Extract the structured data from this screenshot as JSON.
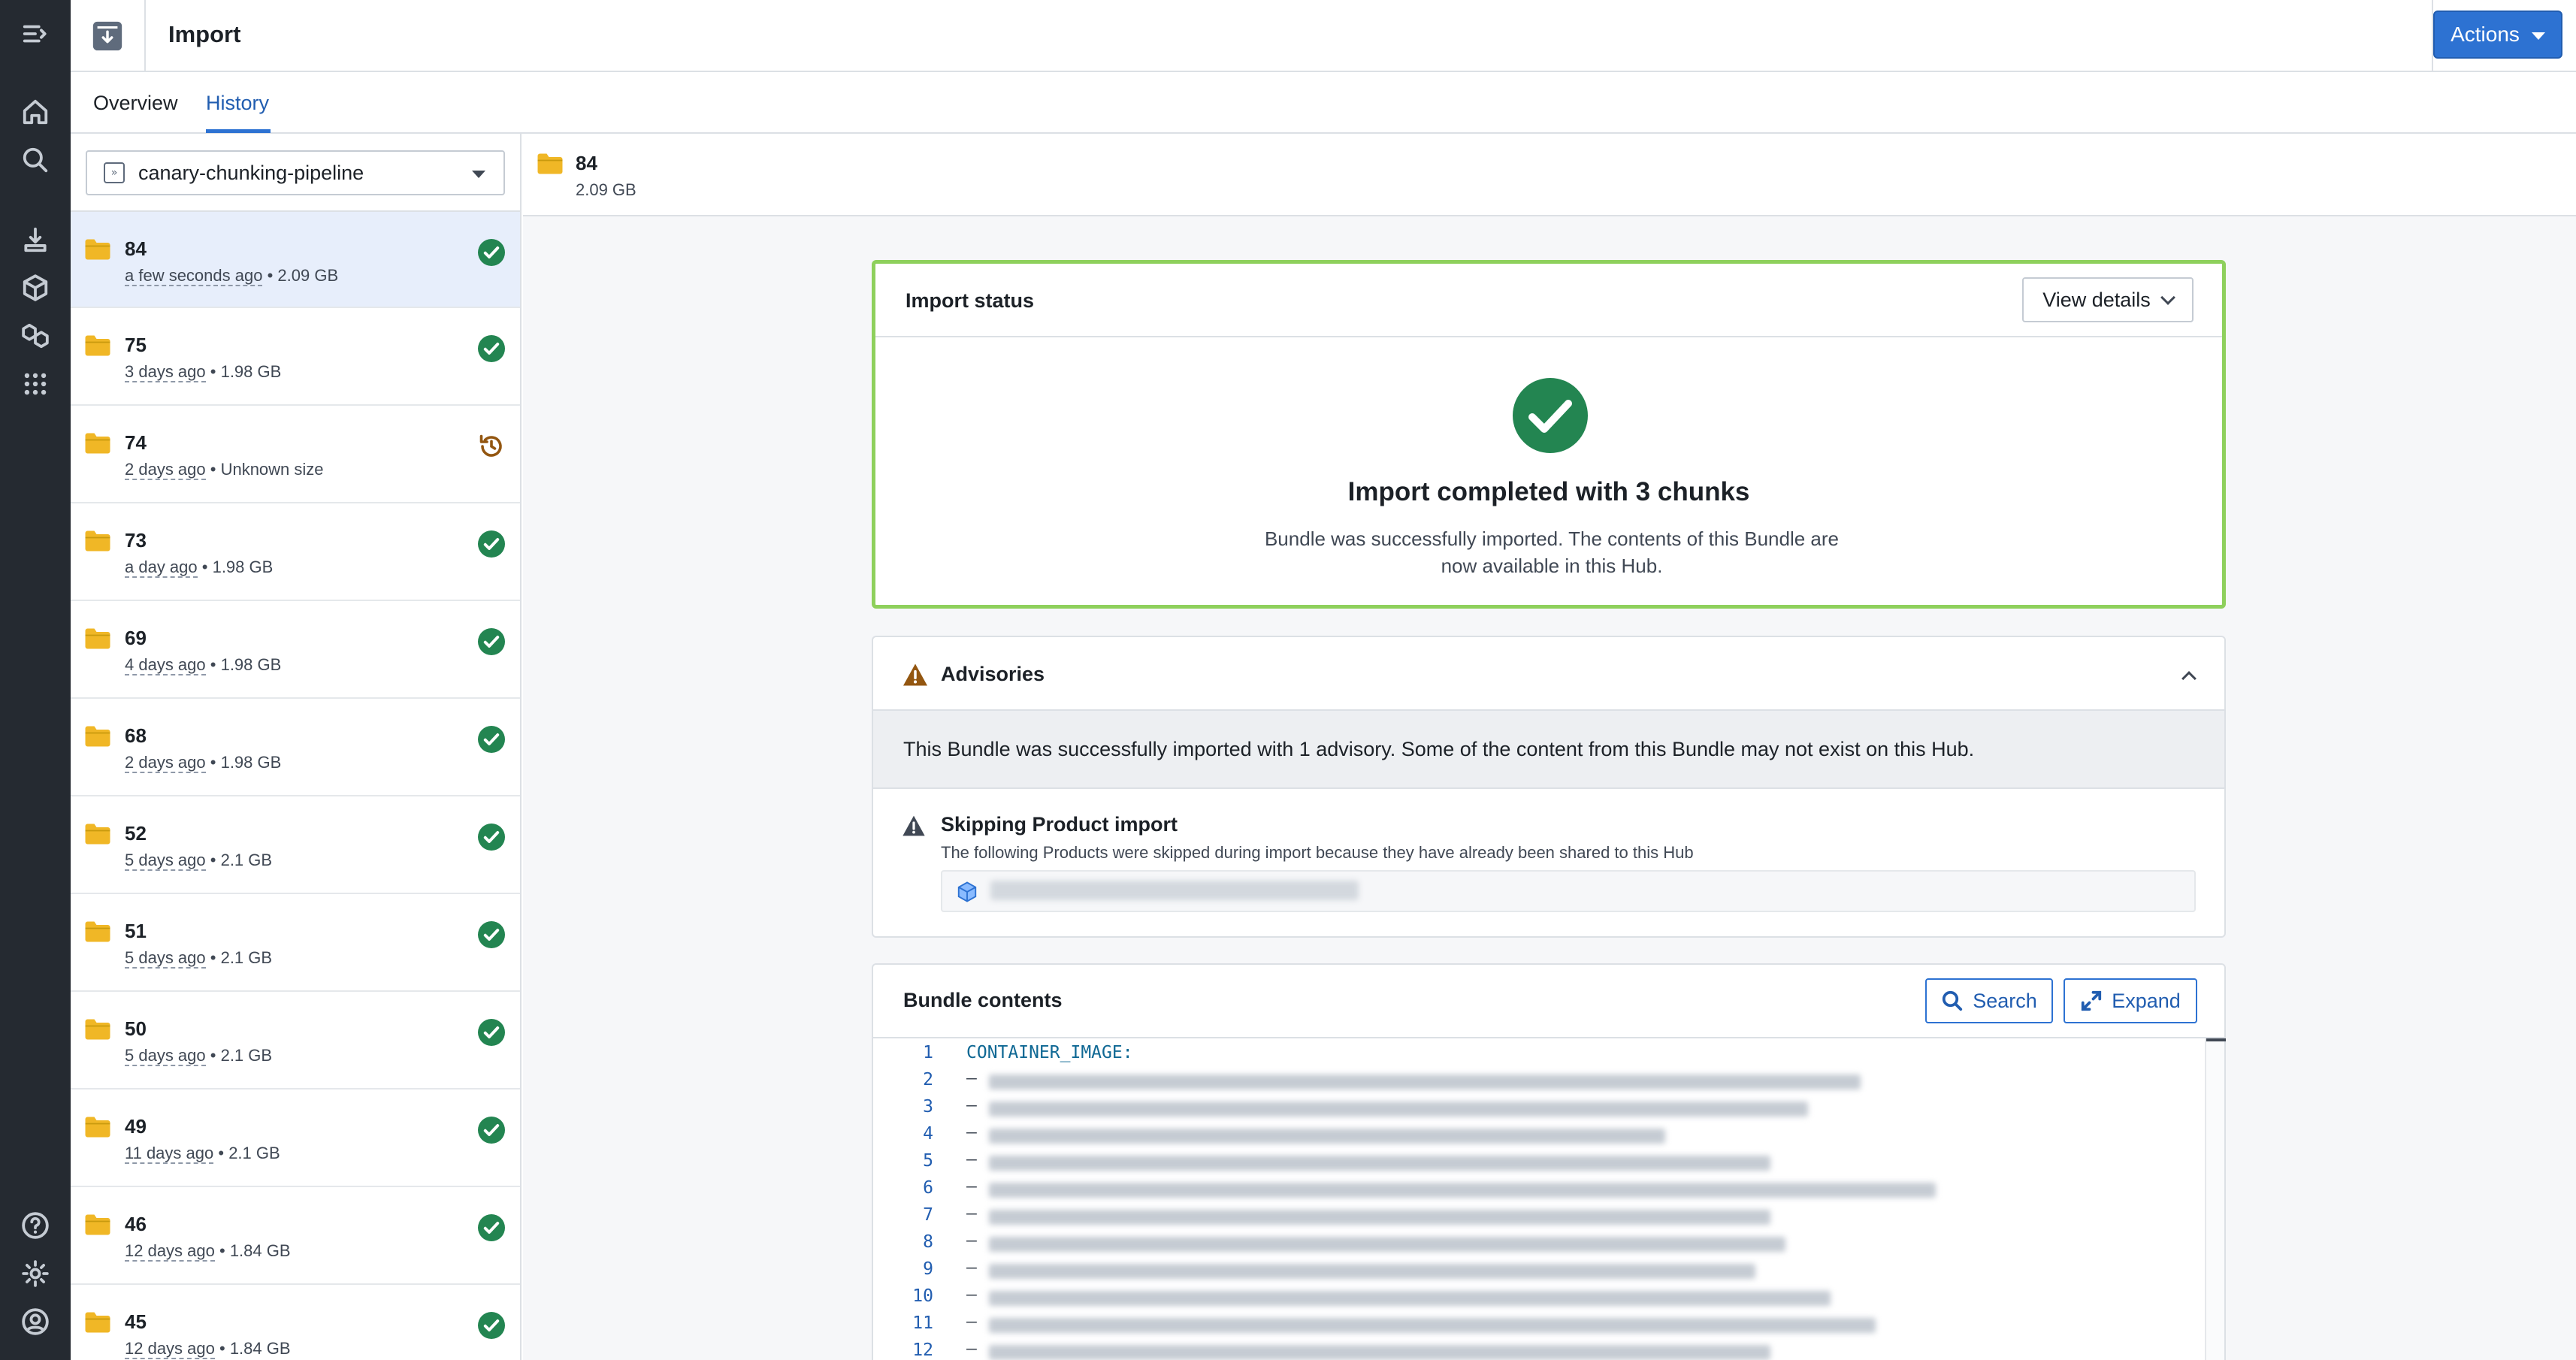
{
  "header": {
    "title": "Import",
    "actions_label": "Actions"
  },
  "tabs": [
    {
      "label": "Overview",
      "active": false
    },
    {
      "label": "History",
      "active": true
    }
  ],
  "pipeline_select": {
    "value": "canary-chunking-pipeline"
  },
  "history": [
    {
      "id": "84",
      "age": "a few seconds ago",
      "size": "2.09 GB",
      "status": "success",
      "selected": true
    },
    {
      "id": "75",
      "age": "3 days ago",
      "size": "1.98 GB",
      "status": "success"
    },
    {
      "id": "74",
      "age": "2 days ago",
      "size": "Unknown size",
      "status": "history"
    },
    {
      "id": "73",
      "age": "a day ago",
      "size": "1.98 GB",
      "status": "success"
    },
    {
      "id": "69",
      "age": "4 days ago",
      "size": "1.98 GB",
      "status": "success"
    },
    {
      "id": "68",
      "age": "2 days ago",
      "size": "1.98 GB",
      "status": "success"
    },
    {
      "id": "52",
      "age": "5 days ago",
      "size": "2.1 GB",
      "status": "success"
    },
    {
      "id": "51",
      "age": "5 days ago",
      "size": "2.1 GB",
      "status": "success"
    },
    {
      "id": "50",
      "age": "5 days ago",
      "size": "2.1 GB",
      "status": "success"
    },
    {
      "id": "49",
      "age": "11 days ago",
      "size": "2.1 GB",
      "status": "success"
    },
    {
      "id": "46",
      "age": "12 days ago",
      "size": "1.84 GB",
      "status": "success"
    },
    {
      "id": "45",
      "age": "12 days ago",
      "size": "1.84 GB",
      "status": "success"
    }
  ],
  "selected": {
    "id": "84",
    "size": "2.09 GB"
  },
  "import_status": {
    "title": "Import status",
    "view_details_label": "View details",
    "heading": "Import completed with 3 chunks",
    "description": "Bundle was successfully imported. The contents of this Bundle are now available in this Hub."
  },
  "advisories": {
    "title": "Advisories",
    "banner": "This Bundle was successfully imported with 1 advisory. Some of the content from this Bundle may not exist on this Hub.",
    "item_title": "Skipping Product import",
    "item_description": "The following Products were skipped during import because they have already been shared to this Hub"
  },
  "bundle_contents": {
    "title": "Bundle contents",
    "search_label": "Search",
    "expand_label": "Expand",
    "first_line": "CONTAINER_IMAGE:",
    "line_numbers": [
      "1",
      "2",
      "3",
      "4",
      "5",
      "6",
      "7",
      "8",
      "9",
      "10",
      "11",
      "12"
    ],
    "dash": "–"
  },
  "colors": {
    "rail": "#252a31",
    "accent": "#2d72d2",
    "success": "#238551",
    "warning": "#935610",
    "folder": "#f0b726",
    "status_border": "#8ed05c"
  }
}
